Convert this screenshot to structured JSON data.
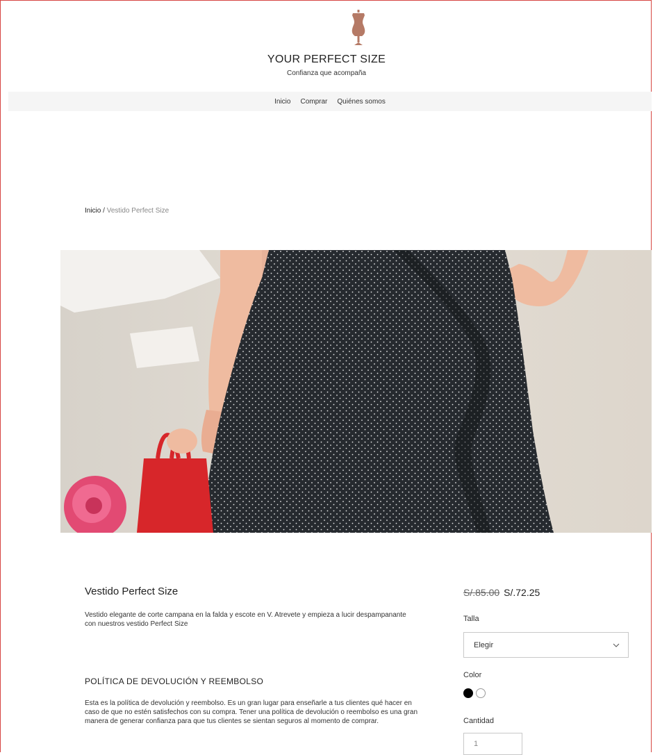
{
  "header": {
    "title": "YOUR PERFECT SIZE",
    "tagline": "Confianza que acompaña",
    "logo_icon": "dress-form-icon",
    "logo_color": "#b57a66"
  },
  "nav": {
    "items": [
      {
        "label": "Inicio"
      },
      {
        "label": "Comprar"
      },
      {
        "label": "Quiénes somos"
      }
    ]
  },
  "breadcrumb": {
    "home": "Inicio",
    "separator": " / ",
    "current": "Vestido Perfect Size"
  },
  "product": {
    "title": "Vestido Perfect Size",
    "description": "Vestido elegante de corte campana en la falda y escote en V. Atrevete y empieza a lucir despampanante con nuestros vestido Perfect Size",
    "price_old": "S/.85.00",
    "price_new": "S/.72.25"
  },
  "policy": {
    "title": "POLÍTICA DE DEVOLUCIÓN Y REEMBOLSO",
    "text": "Esta es la política de devolución y reembolso. Es un gran lugar para enseñarle a tus clientes qué hacer en caso de que no estén satisfechos con su compra. Tener una política de devolución o reembolso es una gran manera de generar confianza para que tus clientes se sientan seguros al momento de comprar."
  },
  "options": {
    "size_label": "Talla",
    "size_value": "Elegir",
    "color_label": "Color",
    "colors": [
      "#000000",
      "#ffffff"
    ],
    "quantity_label": "Cantidad",
    "quantity_value": "1"
  },
  "colors": {
    "frame_border": "#d64541",
    "nav_background": "#f5f5f5"
  }
}
